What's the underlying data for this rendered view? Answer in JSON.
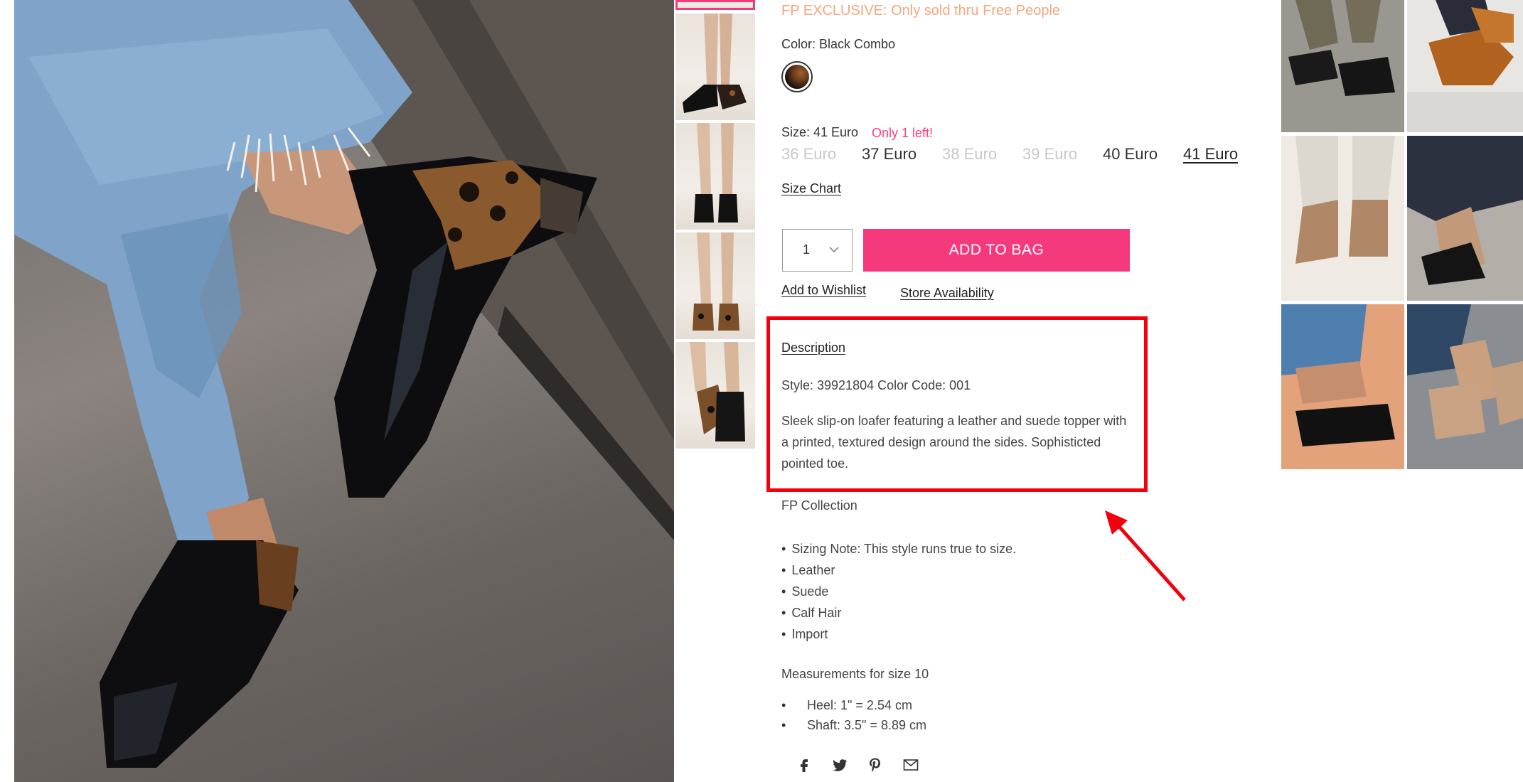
{
  "product": {
    "exclusive_text": "FP EXCLUSIVE: Only sold thru Free People",
    "color_label": "Color: Black Combo",
    "size_label": "Size: 41 Euro",
    "stock_note": "Only 1 left!",
    "sizes": [
      {
        "label": "36 Euro",
        "state": "unavailable"
      },
      {
        "label": "37 Euro",
        "state": "available"
      },
      {
        "label": "38 Euro",
        "state": "unavailable"
      },
      {
        "label": "39 Euro",
        "state": "unavailable"
      },
      {
        "label": "40 Euro",
        "state": "available"
      },
      {
        "label": "41 Euro",
        "state": "selected"
      }
    ],
    "size_chart_link": "Size Chart",
    "quantity": "1",
    "add_to_bag": "ADD TO BAG",
    "wishlist_link": "Add to Wishlist",
    "store_link": "Store Availability"
  },
  "description": {
    "heading": "Description",
    "style_line": "Style: 39921804 Color Code: 001",
    "body": "Sleek slip-on loafer featuring a leather and suede topper with a printed, textured design around the sides. Sophisticted pointed toe.",
    "collection": "FP Collection",
    "bullets": [
      "Sizing Note: This style runs true to size.",
      "Leather",
      "Suede",
      "Calf Hair",
      "Import"
    ],
    "measurements_heading": "Measurements for size 10",
    "measurements": [
      "Heel: 1\" = 2.54 cm",
      "Shaft: 3.5\" = 8.89 cm"
    ]
  },
  "social": [
    "facebook-icon",
    "twitter-icon",
    "pinterest-icon",
    "email-icon"
  ],
  "colors": {
    "accent": "#f43a7c",
    "exclusive": "#f7a47e",
    "stock": "#ff3c82",
    "highlight": "#f3000d"
  }
}
